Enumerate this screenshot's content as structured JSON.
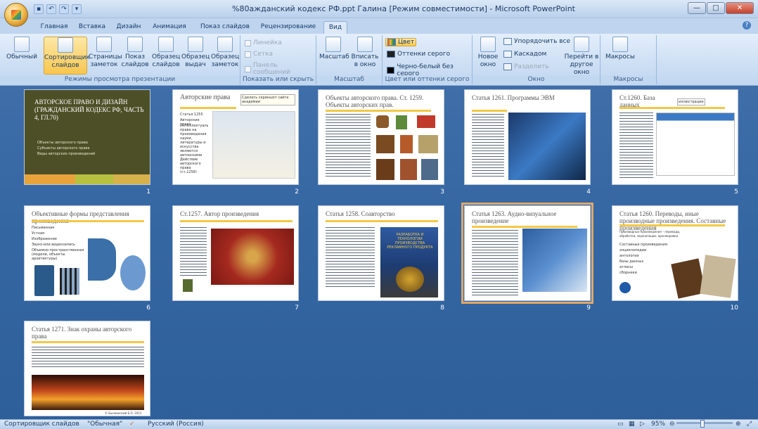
{
  "window": {
    "title": "%80aжданский кодекс РФ.ppt Галина [Режим совместимости] - Microsoft PowerPoint",
    "minimize": "—",
    "maximize": "□",
    "close": "✕"
  },
  "qat": {
    "save": "▪",
    "undo": "↶",
    "redo": "↷",
    "customize": "▾"
  },
  "tabs": [
    "Главная",
    "Вставка",
    "Дизайн",
    "Анимация",
    "Показ слайдов",
    "Рецензирование",
    "Вид"
  ],
  "active_tab": "Вид",
  "ribbon": {
    "groups": {
      "views": {
        "label": "Режимы просмотра презентации",
        "buttons": [
          "Обычный",
          "Сортировщик слайдов",
          "Страницы заметок",
          "Показ слайдов",
          "Образец слайдов",
          "Образец выдач",
          "Образец заметок"
        ]
      },
      "show_hide": {
        "label": "Показать или скрыть",
        "items": [
          "Линейка",
          "Сетка",
          "Панель сообщений"
        ]
      },
      "zoom": {
        "label": "Масштаб",
        "buttons": [
          "Масштаб",
          "Вписать в окно"
        ]
      },
      "color": {
        "label": "Цвет или оттенки серого",
        "items": [
          "Цвет",
          "Оттенки серого",
          "Черно-белый без серого"
        ]
      },
      "window": {
        "label": "Окно",
        "new_window": "Новое окно",
        "arrange_all": "Упорядочить все",
        "cascade": "Каскадом",
        "split": "Разделить",
        "switch": "Перейти в другое окно"
      },
      "macros": {
        "label": "Макросы",
        "button": "Макросы"
      }
    }
  },
  "slides": [
    {
      "num": "1",
      "title": "АВТОРСКОЕ ПРАВО И ДИЗАЙН (ГРАЖДАНСКИЙ КОДЕКС РФ, ЧАСТЬ 4, ГЛ.70)",
      "bullets": [
        "Объекты авторского права",
        "Субъекты авторского права",
        "Виды авторских произведений"
      ]
    },
    {
      "num": "2",
      "title": "Авторские права",
      "note": "Сделать скриншот сайта академии",
      "bullets": [
        "Статья 1255",
        "Авторские права",
        "Интеллектуальные права на произведения науки, литературы и искусства являются авторскими правами",
        "Действие авторского права (ст.1256)"
      ]
    },
    {
      "num": "3",
      "title": "Объекты авторского права. Ст. 1259. Объекты авторских прав."
    },
    {
      "num": "4",
      "title": "Статья 1261. Программы ЭВМ"
    },
    {
      "num": "5",
      "title": "Ст.1260. База данных",
      "note": "иллюстрации"
    },
    {
      "num": "6",
      "title": "Объективные формы представления произведения",
      "bullets": [
        "Письменная",
        "Устная",
        "Изображение",
        "Звуко-или видеозапись",
        "Объемно-пространственная (модели, объекты архитектуры)"
      ]
    },
    {
      "num": "7",
      "title": "Ст.1257. Автор произведения"
    },
    {
      "num": "8",
      "title": "Статья 1258. Соавторство",
      "book": "РАЗРАБОТКА И ТЕХНОЛОГИИ ПРОИЗВОДСТВА РЕКЛАМНОГО ПРОДУКТА"
    },
    {
      "num": "9",
      "title": "Статья 1263. Аудио-визуальное произведение"
    },
    {
      "num": "10",
      "title": "Статья 1260. Переводы, иные производные произведения. Составные произведения",
      "bullets": [
        "Производные произведения – переводы, обработки, экранизации, аранжировки",
        "Составные произведения:",
        "энциклопедии",
        "антологии",
        "базы данных",
        "атласы",
        "сборники"
      ]
    },
    {
      "num": "11",
      "title": "Статья 1271. Знак охраны авторского права",
      "caption": "© Былкинский Б.О. 2011"
    }
  ],
  "status": {
    "view": "Сортировщик слайдов",
    "theme": "\"Обычная\"",
    "language": "Русский (Россия)",
    "zoom": "95%"
  }
}
